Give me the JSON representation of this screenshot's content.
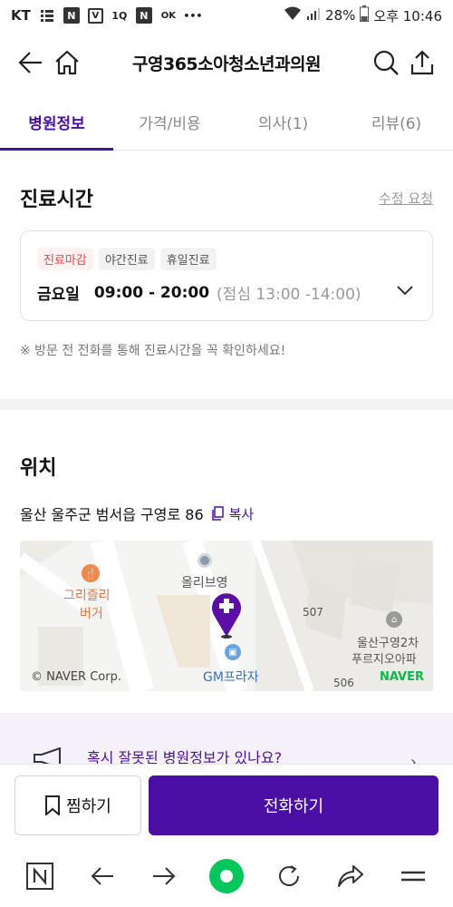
{
  "status_bar": {
    "carrier": "KT",
    "icons": [
      "grid-icon",
      "naver-icon",
      "shield-icon",
      "app-icon",
      "naver-icon",
      "ok-icon",
      "more-icon"
    ],
    "battery": "28%",
    "time": "오후 10:46"
  },
  "header": {
    "title": "구영365소아청소년과의원"
  },
  "tabs": [
    {
      "label": "병원정보",
      "active": true
    },
    {
      "label": "가격/비용",
      "active": false
    },
    {
      "label": "의사(1)",
      "active": false
    },
    {
      "label": "리뷰(6)",
      "active": false
    }
  ],
  "hours": {
    "title": "진료시간",
    "edit_link": "수정 요청",
    "badges": [
      "진료마감",
      "야간진료",
      "휴일진료"
    ],
    "day": "금요일",
    "time": "09:00 - 20:00",
    "lunch": "(점심 13:00 -14:00)",
    "notice": "※ 방문 전 전화를 통해 진료시간을 꼭 확인하세요!"
  },
  "location": {
    "title": "위치",
    "address": "울산 울주군 범서읍 구영로 86",
    "copy_label": "복사",
    "map": {
      "poi_1": "그리즐리",
      "poi_1b": "버거",
      "poi_2": "올리브영",
      "poi_3": "GM프라자",
      "poi_4": "울산구영2차",
      "poi_4b": "푸르지오아파",
      "num_507": "507",
      "num_506": "506",
      "copyright": "© NAVER Corp.",
      "brand": "NAVER"
    }
  },
  "report": {
    "text": "혹시 잘못된 병원정보가 있나요?"
  },
  "actions": {
    "bookmark_label": "찜하기",
    "call_label": "전화하기"
  },
  "colors": {
    "accent": "#4b0fa6",
    "closed": "#e8464f",
    "naver_green": "#0bbb4a"
  }
}
